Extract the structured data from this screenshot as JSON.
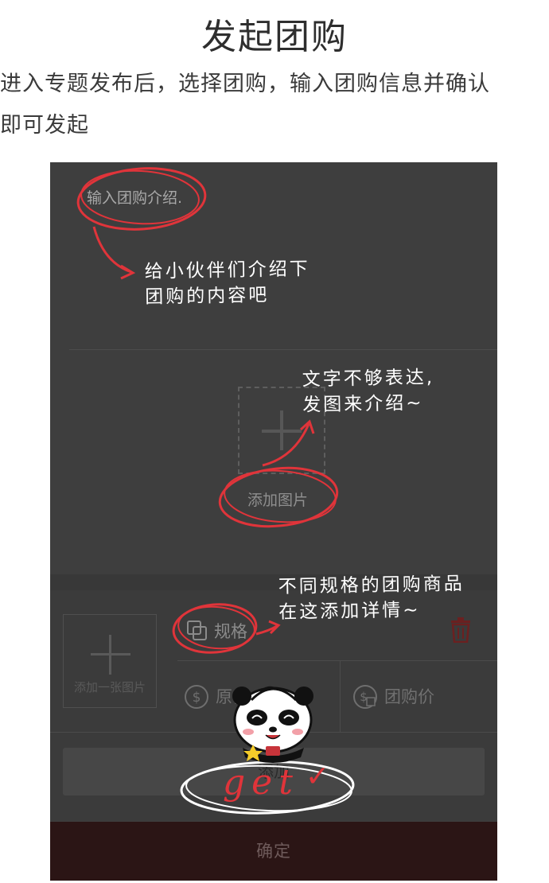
{
  "header": {
    "title": "发起团购",
    "intro_line1": "进入专题发布后，选择团购，输入团购信息并确认",
    "intro_line2": "即可发起"
  },
  "form": {
    "intro_placeholder": "输入团购介绍.",
    "add_image_label": "添加图片",
    "spec_photo_label": "添加一张图片",
    "spec_label": "规格",
    "original_price_label": "原价",
    "group_price_label": "团购价",
    "add_button_label": "添加",
    "confirm_label": "确定"
  },
  "annotations": {
    "note_intro_line1": "给小伙伴们介绍下",
    "note_intro_line2": "团购的内容吧",
    "note_image_line1": "文字不够表达,",
    "note_image_line2": "发图来介绍~",
    "note_spec_line1": "不同规格的团购商品",
    "note_spec_line2": "在这添加详情~",
    "get_text": "get",
    "get_check": "✓"
  },
  "colors": {
    "accent_red": "#e0343a",
    "dim_overlay": "#3e3e3e",
    "confirm_bar": "#2b1515"
  }
}
